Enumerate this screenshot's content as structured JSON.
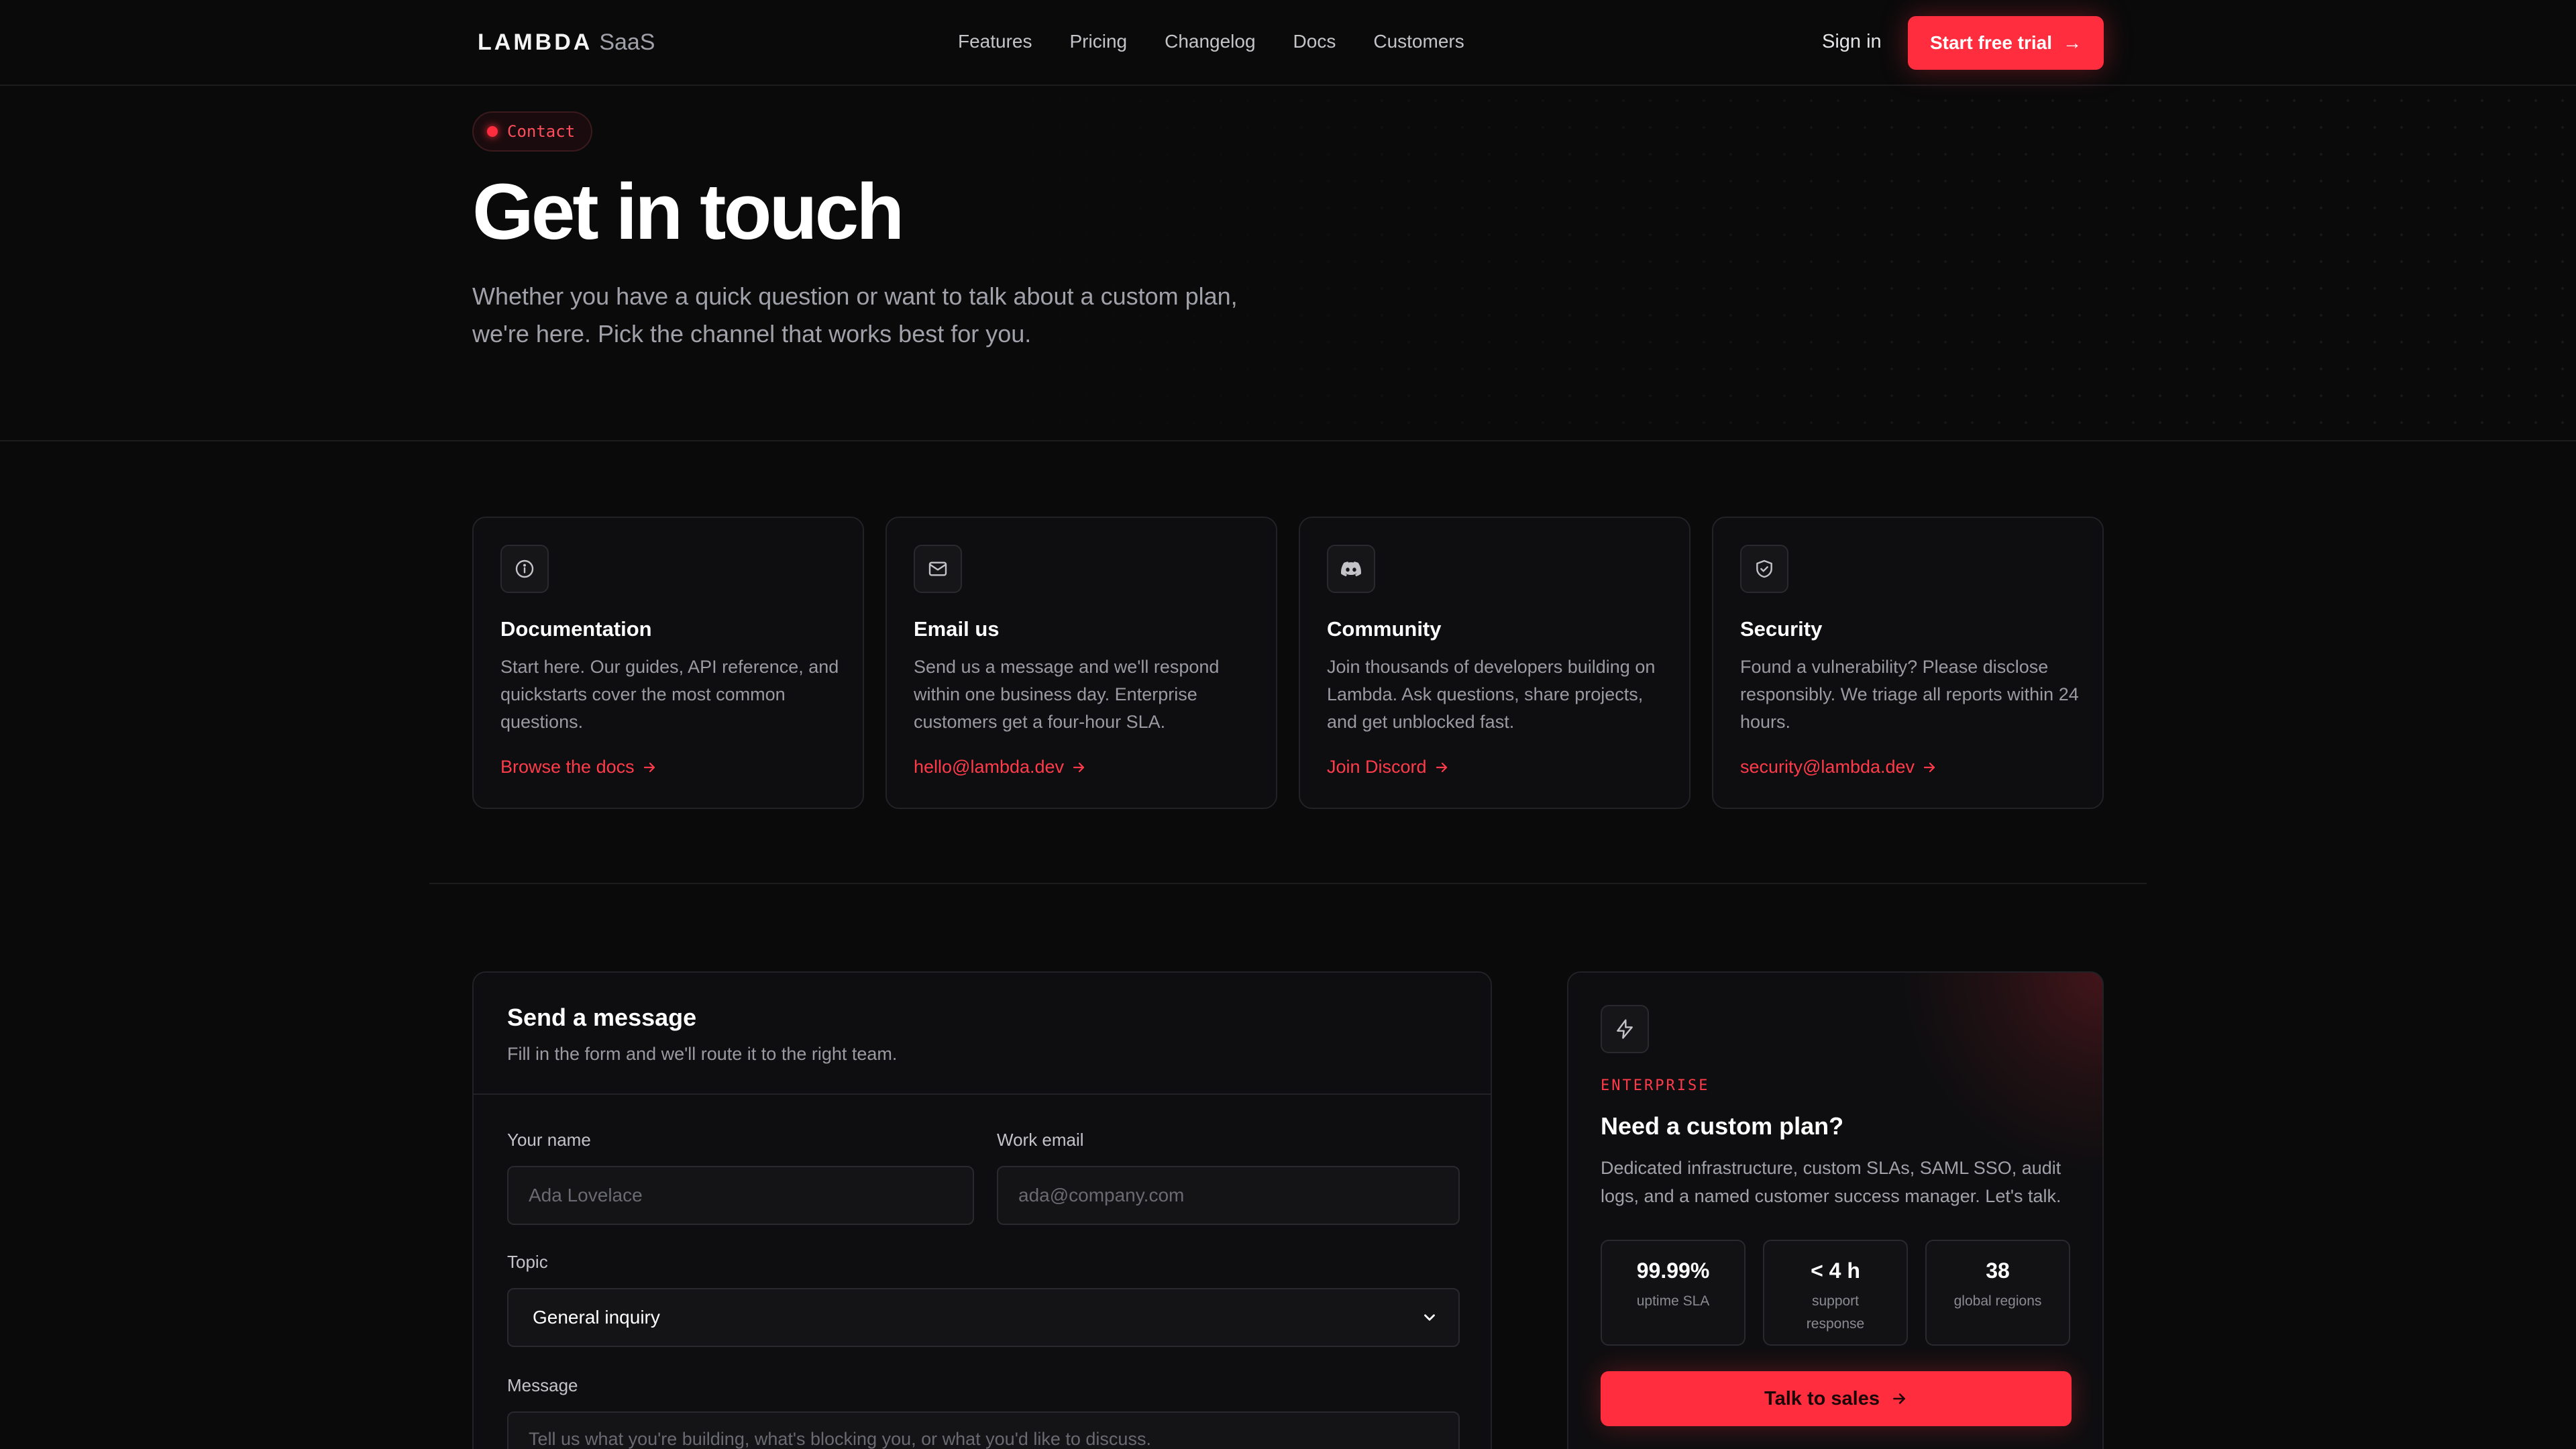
{
  "nav": {
    "logo": "LAMBDA",
    "logo_sub": "SaaS",
    "links": [
      "Features",
      "Pricing",
      "Changelog",
      "Docs",
      "Customers"
    ],
    "sign_in": "Sign in",
    "cta": "Start free trial",
    "cta_arrow": "→"
  },
  "hero": {
    "badge": "Contact",
    "title": "Get in touch",
    "subtitle": "Whether you have a quick question or want to talk about a custom plan, we're here. Pick the channel that works best for you."
  },
  "cards": [
    {
      "icon": "info-icon",
      "title": "Documentation",
      "desc": "Start here. Our guides, API reference, and quickstarts cover the most common questions.",
      "link": "Browse the docs"
    },
    {
      "icon": "mail-icon",
      "title": "Email us",
      "desc": "Send us a message and we'll respond within one business day. Enterprise customers get a four-hour SLA.",
      "link": "hello@lambda.dev"
    },
    {
      "icon": "discord-icon",
      "title": "Community",
      "desc": "Join thousands of developers building on Lambda. Ask questions, share projects, and get unblocked fast.",
      "link": "Join Discord"
    },
    {
      "icon": "shield-icon",
      "title": "Security",
      "desc": "Found a vulnerability? Please disclose responsibly. We triage all reports within 24 hours.",
      "link": "security@lambda.dev"
    }
  ],
  "form": {
    "title": "Send a message",
    "subtitle": "Fill in the form and we'll route it to the right team.",
    "name_label": "Your name",
    "name_placeholder": "Ada Lovelace",
    "email_label": "Work email",
    "email_placeholder": "ada@company.com",
    "topic_label": "Topic",
    "topic_value": "General inquiry",
    "message_label": "Message",
    "message_placeholder": "Tell us what you're building, what's blocking you, or what you'd like to discuss."
  },
  "enterprise": {
    "icon": "bolt-icon",
    "eyebrow": "ENTERPRISE",
    "title": "Need a custom plan?",
    "desc": "Dedicated infrastructure, custom SLAs, SAML SSO, audit logs, and a named customer success manager. Let's talk.",
    "stats": [
      {
        "value": "99.99%",
        "label": "uptime SLA"
      },
      {
        "value": "< 4 h",
        "label": "support response"
      },
      {
        "value": "38",
        "label": "global regions"
      }
    ],
    "cta": "Talk to sales"
  },
  "colors": {
    "accent": "#ff2d3d",
    "background": "#0a0a0b",
    "card": "#0e0e10",
    "border": "#222226"
  }
}
